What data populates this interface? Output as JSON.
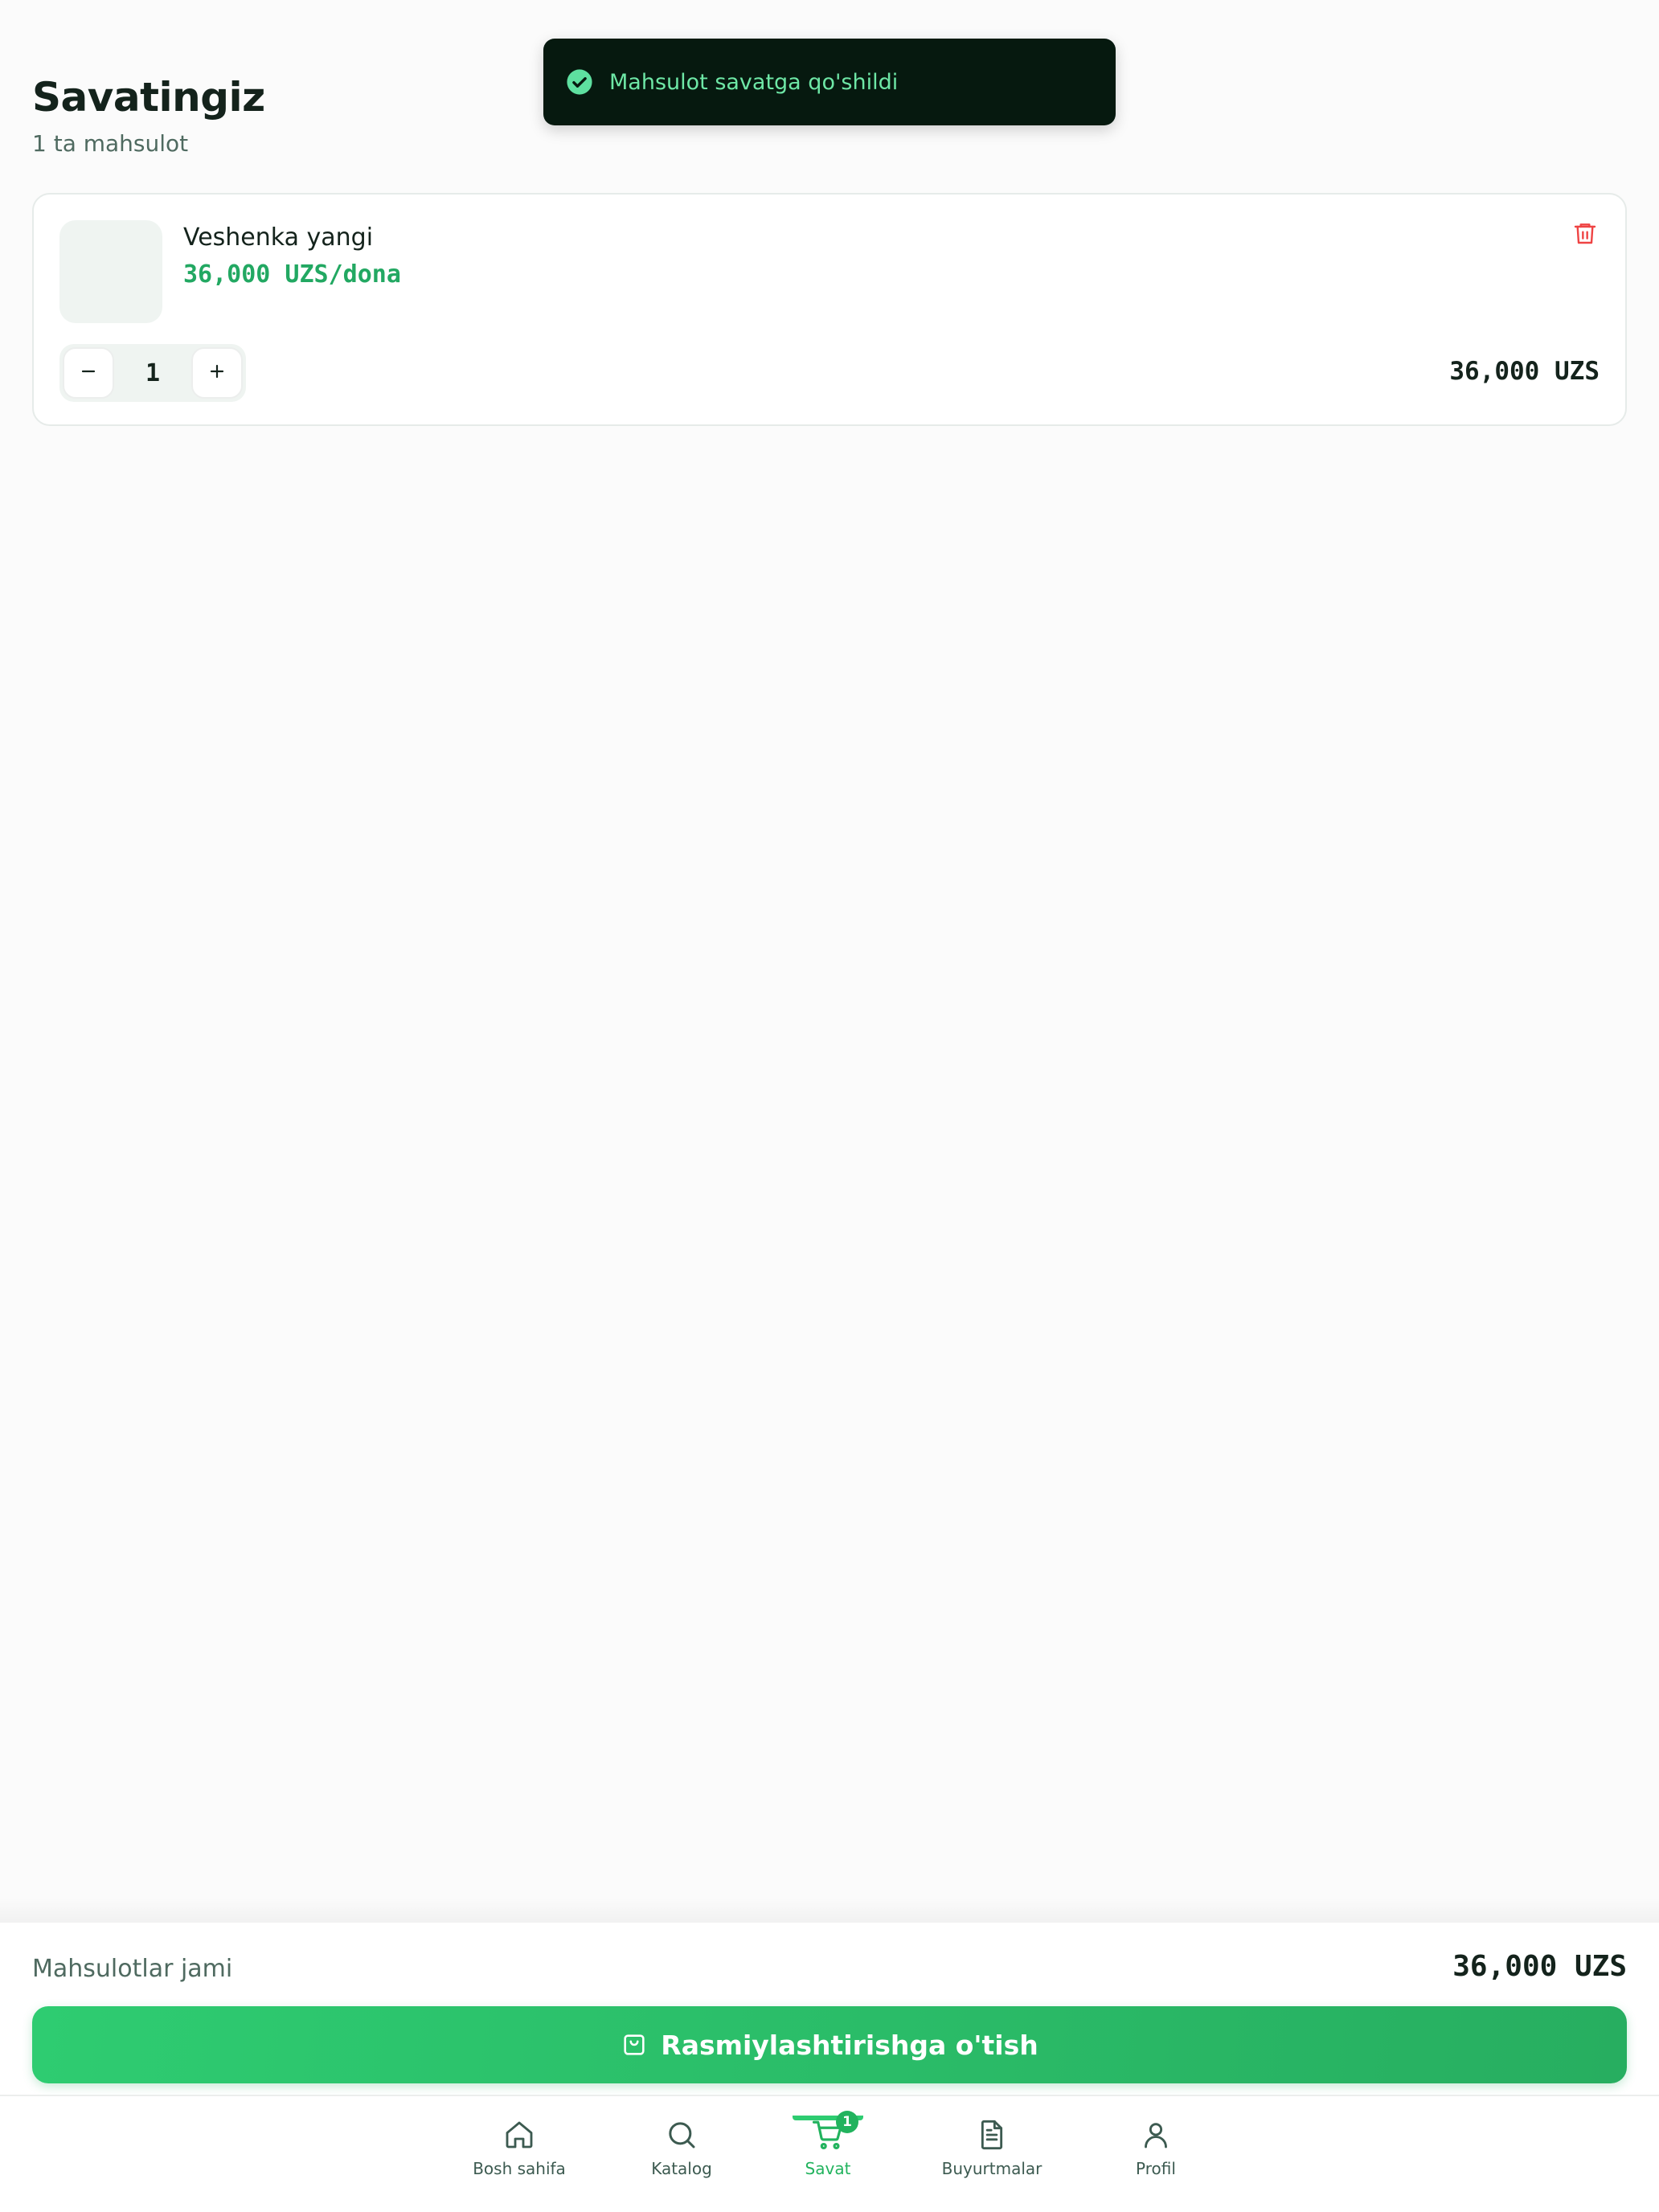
{
  "toast": {
    "message": "Mahsulot savatga qo'shildi",
    "icon": "check-circle-icon"
  },
  "header": {
    "title": "Savatingiz",
    "subtitle": "1 ta mahsulot"
  },
  "cart": {
    "items": [
      {
        "name": "Veshenka yangi",
        "unit_price": "36,000 UZS/dona",
        "quantity": "1",
        "total": "36,000 UZS"
      }
    ]
  },
  "summary": {
    "label": "Mahsulotlar jami",
    "value": "36,000 UZS",
    "checkout_label": "Rasmiylashtirishga o'tish"
  },
  "nav": {
    "items": [
      {
        "label": "Bosh sahifa",
        "icon": "home-icon"
      },
      {
        "label": "Katalog",
        "icon": "search-icon"
      },
      {
        "label": "Savat",
        "icon": "cart-icon",
        "badge": "1",
        "active": true
      },
      {
        "label": "Buyurtmalar",
        "icon": "document-icon"
      },
      {
        "label": "Profil",
        "icon": "user-icon"
      }
    ]
  },
  "colors": {
    "accent": "#2ecc71",
    "accent_dark": "#27ae60",
    "price_green": "#22a862",
    "toast_bg": "#06190f",
    "toast_text": "#6ee7a6",
    "delete_red": "#ef4444"
  }
}
